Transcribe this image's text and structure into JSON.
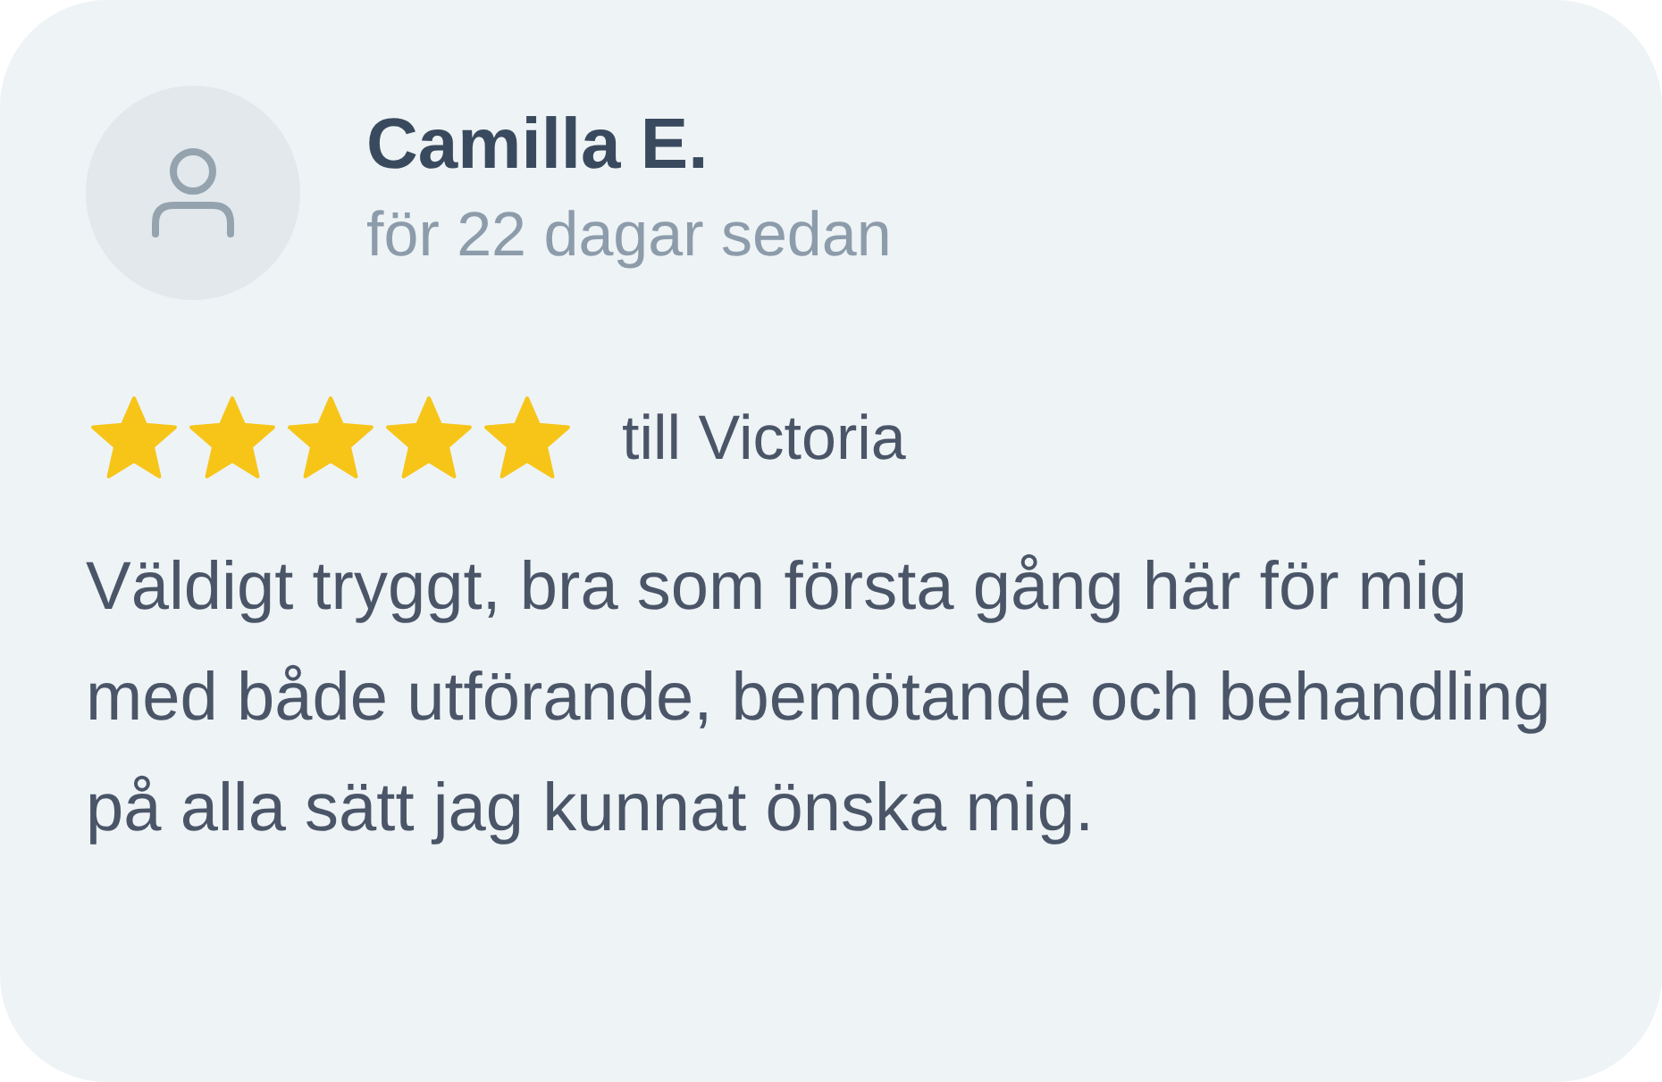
{
  "review": {
    "author": "Camilla E.",
    "time": "för 22 dagar sedan",
    "stars": 5,
    "recipient": "till Victoria",
    "text": "Väldigt tryggt, bra som första gång här för mig med både utförande, bemötande och behandling på alla sätt jag kunnat önska mig."
  }
}
